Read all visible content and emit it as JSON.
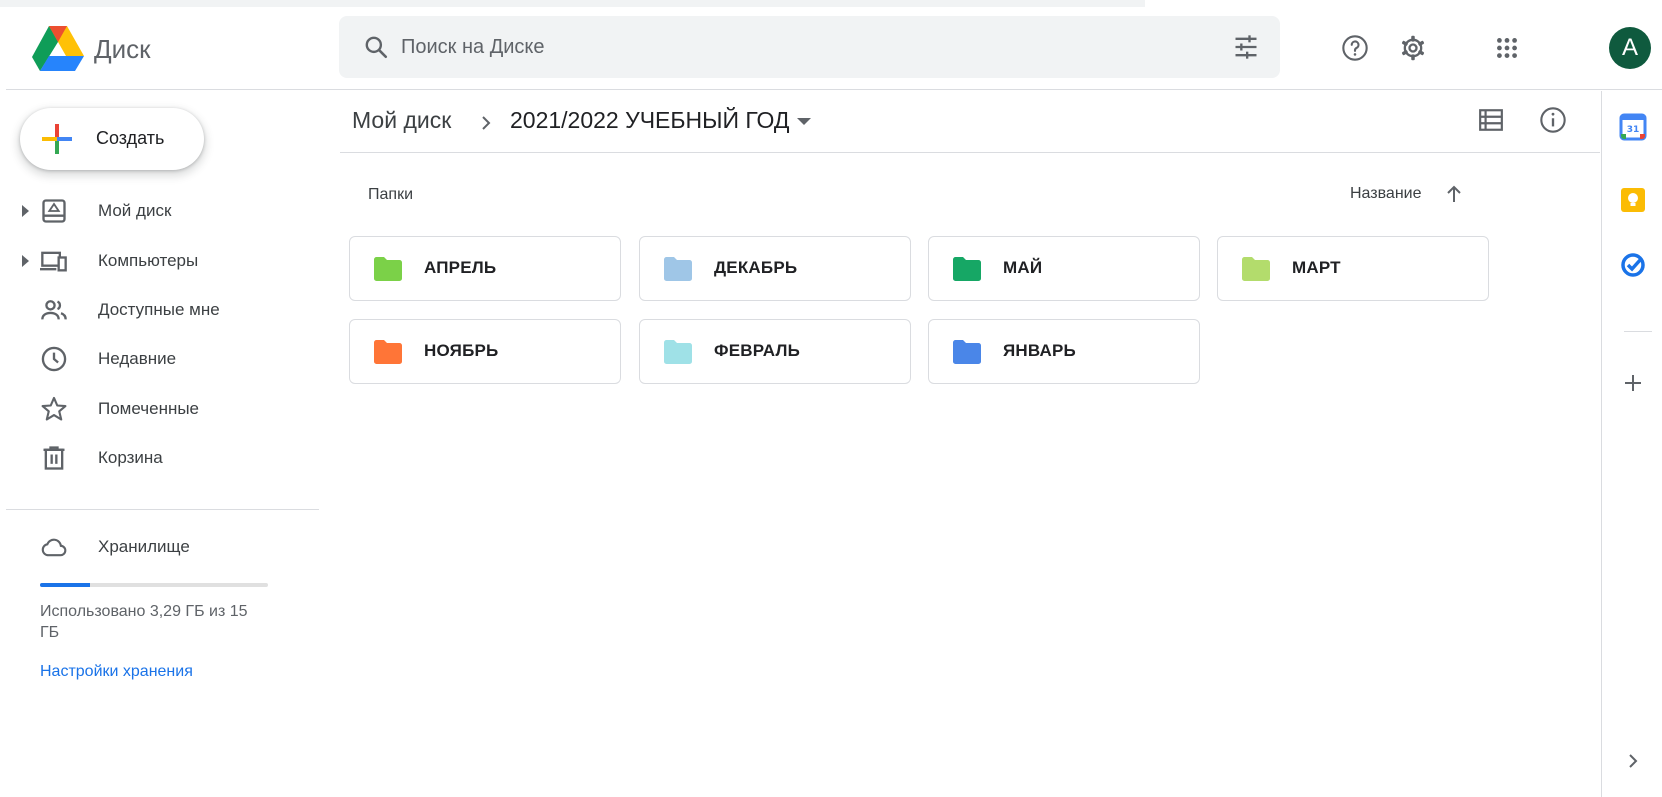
{
  "app": {
    "title": "Диск"
  },
  "search": {
    "placeholder": "Поиск на Диске",
    "value": ""
  },
  "header": {
    "avatar_letter": "A"
  },
  "sidebar": {
    "create_label": "Создать",
    "items": [
      {
        "label": "Мой диск",
        "icon": "my-drive-icon"
      },
      {
        "label": "Компьютеры",
        "icon": "computers-icon"
      },
      {
        "label": "Доступные мне",
        "icon": "shared-with-me-icon"
      },
      {
        "label": "Недавние",
        "icon": "clock-icon"
      },
      {
        "label": "Помеченные",
        "icon": "star-icon"
      },
      {
        "label": "Корзина",
        "icon": "trash-icon"
      }
    ],
    "storage": {
      "label": "Хранилище",
      "used_text": "Использовано 3,29 ГБ из 15 ГБ",
      "used_fraction": 0.22,
      "link": "Настройки хранения"
    }
  },
  "breadcrumb": {
    "root": "Мой диск",
    "current": "2021/2022 УЧЕБНЫЙ ГОД"
  },
  "main": {
    "section_label": "Папки",
    "sort_label": "Название",
    "folders": [
      {
        "name": "АПРЕЛЬ",
        "color": "#7bd148"
      },
      {
        "name": "ДЕКАБРЬ",
        "color": "#9fc6e7"
      },
      {
        "name": "МАЙ",
        "color": "#16a765"
      },
      {
        "name": "МАРТ",
        "color": "#b3dc6c"
      },
      {
        "name": "НОЯБРЬ",
        "color": "#ff7537"
      },
      {
        "name": "ФЕВРАЛЬ",
        "color": "#9fe1e7"
      },
      {
        "name": "ЯНВАРЬ",
        "color": "#4a86e8"
      }
    ]
  },
  "colors": {
    "accent": "#1a73e8",
    "avatar_bg": "#0f5a3e"
  }
}
